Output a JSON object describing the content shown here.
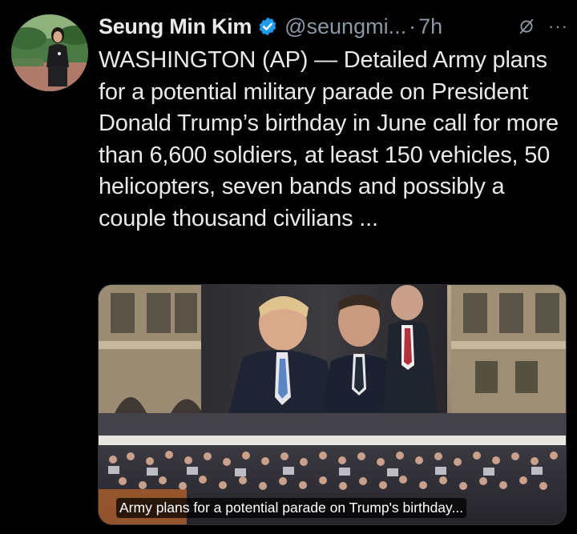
{
  "tweet": {
    "author_name": "Seung Min Kim",
    "handle": "@seungmi...",
    "separator": "·",
    "timestamp": "7h",
    "more_label": "···",
    "text": "WASHINGTON (AP) — Detailed Army plans for a potential military parade on President Donald Trump’s birthday in June call for more than 6,600 soldiers, at least 150 vehicles, 50 helicopters, seven bands and possibly a couple thousand civilians ...",
    "link_card": {
      "caption": "Army plans for a potential parade on Trump's birthday..."
    }
  },
  "icons": {
    "verified": "verified-badge-icon",
    "grok": "grok-icon",
    "more": "more-icon"
  },
  "colors": {
    "background": "#000000",
    "primary_text": "#e7e9ea",
    "secondary_text": "#8b98a5",
    "verified_blue": "#1d9bf0"
  }
}
